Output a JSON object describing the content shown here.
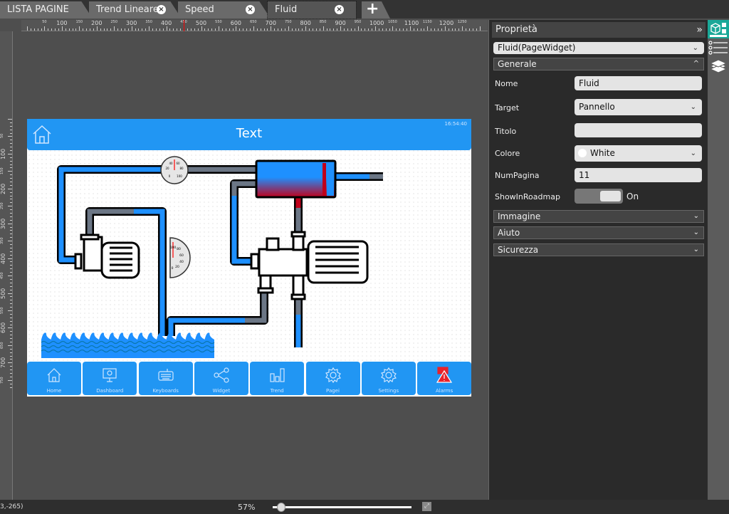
{
  "tabs": [
    {
      "label": "LISTA PAGINE",
      "closable": false
    },
    {
      "label": "Trend Lineare",
      "closable": true
    },
    {
      "label": "Speed",
      "closable": true
    },
    {
      "label": "Fluid",
      "closable": true,
      "active": true
    }
  ],
  "add_tab_icon": "plus-icon",
  "ruler": {
    "horizontal": [
      "50",
      "100",
      "150",
      "200",
      "250",
      "300",
      "350",
      "400",
      "450",
      "500",
      "550",
      "600",
      "650",
      "700",
      "750",
      "800",
      "850",
      "900",
      "950",
      "1000",
      "1050",
      "1100",
      "1150",
      "1200",
      "1250"
    ],
    "vertical": [
      "50",
      "100",
      "150",
      "200",
      "250",
      "300",
      "350",
      "400",
      "450",
      "500",
      "550",
      "600",
      "650",
      "700",
      "750"
    ]
  },
  "page": {
    "header_title": "Text",
    "time": "16:54:40",
    "nav": [
      {
        "label": "Home",
        "icon": "home-icon"
      },
      {
        "label": "Dashboard",
        "icon": "monitor-icon"
      },
      {
        "label": "Keyboards",
        "icon": "keyboard-icon"
      },
      {
        "label": "Widget",
        "icon": "share-icon"
      },
      {
        "label": "Trend",
        "icon": "bar-chart-icon"
      },
      {
        "label": "Pagei",
        "icon": "gear-icon"
      },
      {
        "label": "Settings",
        "icon": "gear-icon"
      },
      {
        "label": "Alarms",
        "icon": "alarm-icon"
      }
    ],
    "gauge1_labels": [
      "40",
      "60",
      "20",
      "80",
      "0",
      "100"
    ],
    "gauge2_labels": [
      "100",
      "80",
      "60",
      "40",
      "0",
      "20"
    ],
    "colors": {
      "header": "#2196f3",
      "fluid": "#1e90ff",
      "empty": "#6b7685",
      "hot": "#c0001a"
    }
  },
  "panel": {
    "title": "Proprietà",
    "widget_select": "Fluid(PageWidget)",
    "section_general": "Generale",
    "fields": {
      "nome_label": "Nome",
      "nome_value": "Fluid",
      "target_label": "Target",
      "target_value": "Pannello",
      "titolo_label": "Titolo",
      "titolo_value": "",
      "colore_label": "Colore",
      "colore_value": "White",
      "numpagina_label": "NumPagina",
      "numpagina_value": "11",
      "roadmap_label": "ShowInRoadmap",
      "roadmap_value": "On"
    },
    "sections": [
      "Immagine",
      "Aiuto",
      "Sicurezza"
    ]
  },
  "status": {
    "coords": "3,-265)",
    "zoom": "57%",
    "zoom_value": 57
  }
}
